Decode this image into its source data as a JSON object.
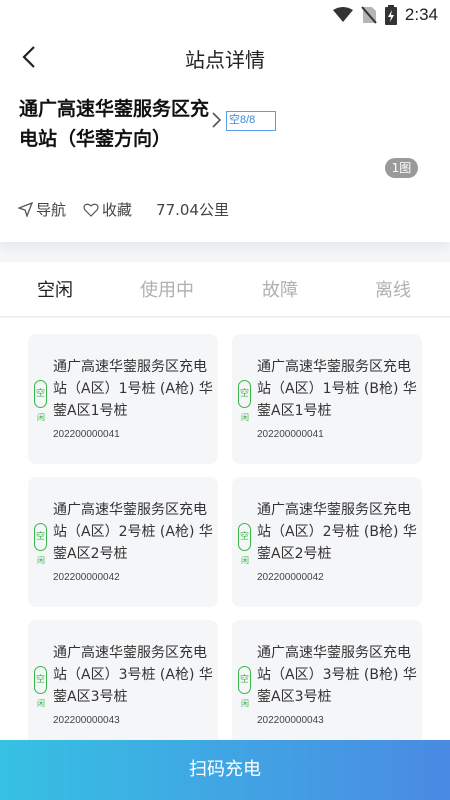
{
  "status_bar": {
    "time": "2:34"
  },
  "header": {
    "title": "站点详情"
  },
  "station": {
    "name": "通广高速华蓥服务区充电站（华蓥方向）",
    "availability": "空8/8",
    "photo_count": "1图",
    "nav_label": "导航",
    "fav_label": "收藏",
    "distance": "77.04公里"
  },
  "tabs": [
    "空闲",
    "使用中",
    "故障",
    "离线"
  ],
  "piles": [
    {
      "status_top": "空",
      "status_bottom": "闲",
      "name": "通广高速华蓥服务区充电站（A区）1号桩 (A枪) 华蓥A区1号桩",
      "code": "202200000041"
    },
    {
      "status_top": "空",
      "status_bottom": "闲",
      "name": "通广高速华蓥服务区充电站（A区）1号桩 (B枪) 华蓥A区1号桩",
      "code": "202200000041"
    },
    {
      "status_top": "空",
      "status_bottom": "闲",
      "name": "通广高速华蓥服务区充电站（A区）2号桩 (A枪) 华蓥A区2号桩",
      "code": "202200000042"
    },
    {
      "status_top": "空",
      "status_bottom": "闲",
      "name": "通广高速华蓥服务区充电站（A区）2号桩 (B枪) 华蓥A区2号桩",
      "code": "202200000042"
    },
    {
      "status_top": "空",
      "status_bottom": "闲",
      "name": "通广高速华蓥服务区充电站（A区）3号桩 (A枪) 华蓥A区3号桩",
      "code": "202200000043"
    },
    {
      "status_top": "空",
      "status_bottom": "闲",
      "name": "通广高速华蓥服务区充电站（A区）3号桩 (B枪) 华蓥A区3号桩",
      "code": "202200000043"
    }
  ],
  "bottom": {
    "scan_label": "扫码充电"
  },
  "colors": {
    "accent_green": "#3ab54a",
    "gradient_start": "#36c1e3",
    "gradient_end": "#4a8ae3"
  }
}
